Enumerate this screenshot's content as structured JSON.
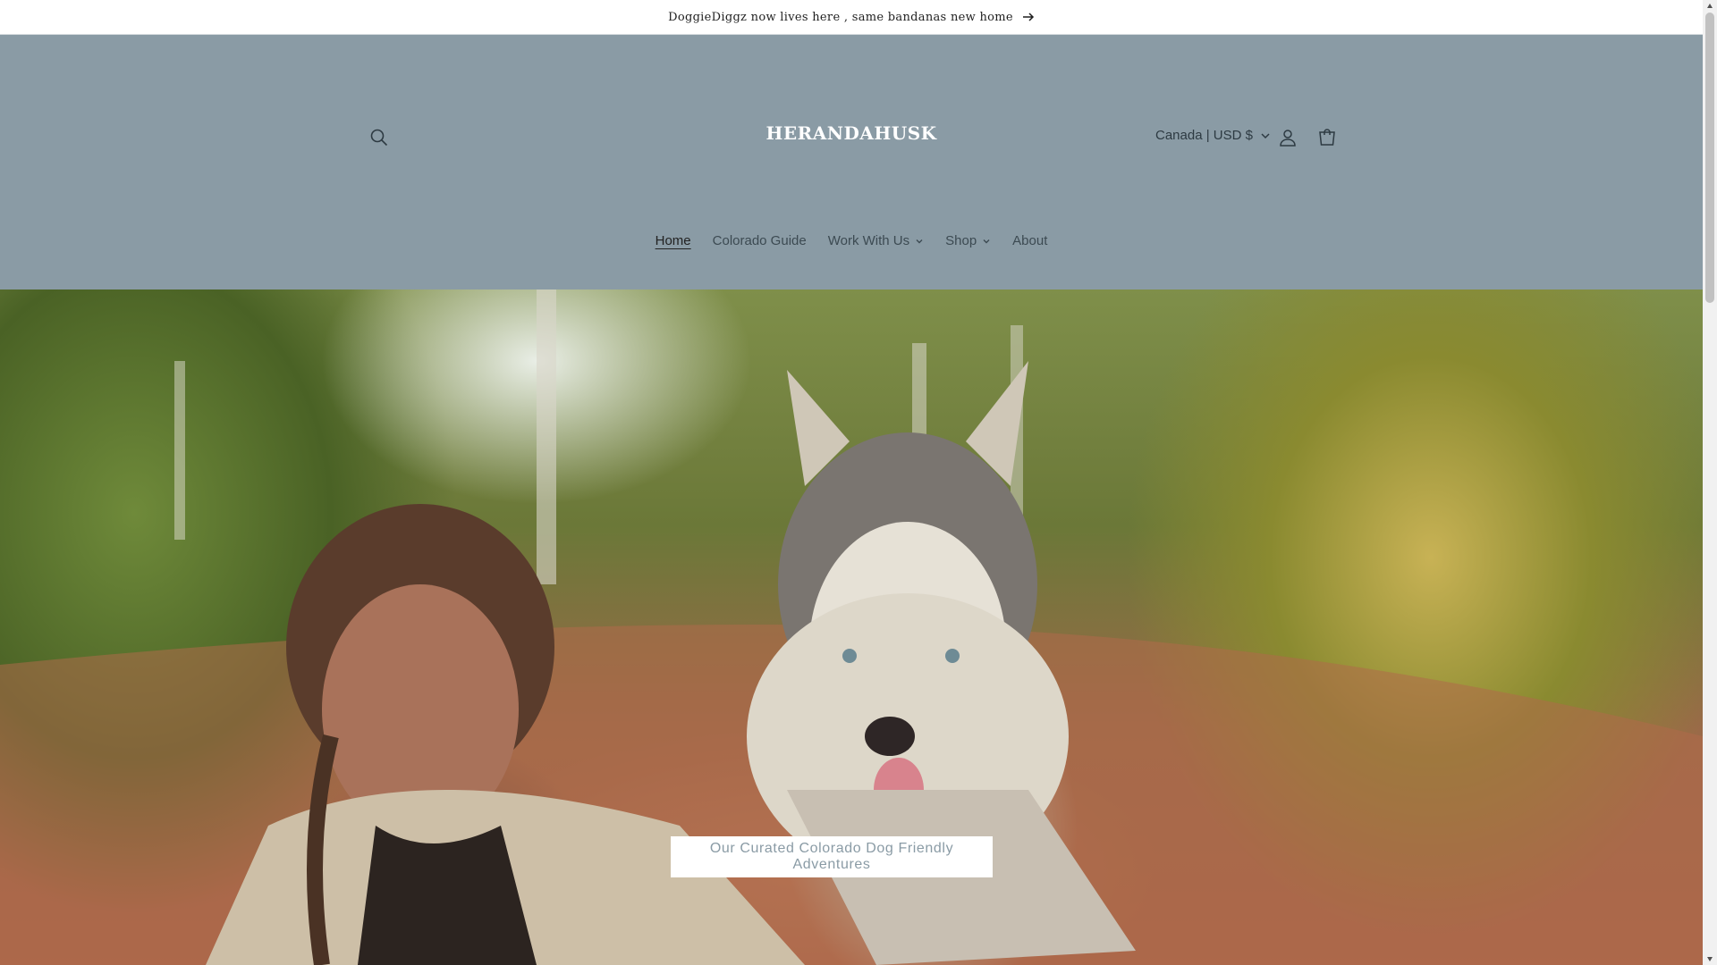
{
  "announcement": {
    "text": "DoggieDiggz now lives here , same bandanas new home",
    "arrow_icon": "arrow-right-icon"
  },
  "header": {
    "logo": "HERANDAHUSK",
    "search_icon": "search-icon",
    "locale": "Canada | USD $",
    "account_icon": "account-icon",
    "cart_icon": "cart-icon",
    "background": "#8a9ba5"
  },
  "nav": {
    "items": [
      {
        "label": "Home",
        "active": true
      },
      {
        "label": "Colorado Guide"
      },
      {
        "label": "Work With Us",
        "dropdown": true
      },
      {
        "label": "Shop",
        "dropdown": true
      },
      {
        "label": "About"
      }
    ]
  },
  "hero": {
    "cta_label": "Our Curated Colorado Dog Friendly Adventures"
  }
}
